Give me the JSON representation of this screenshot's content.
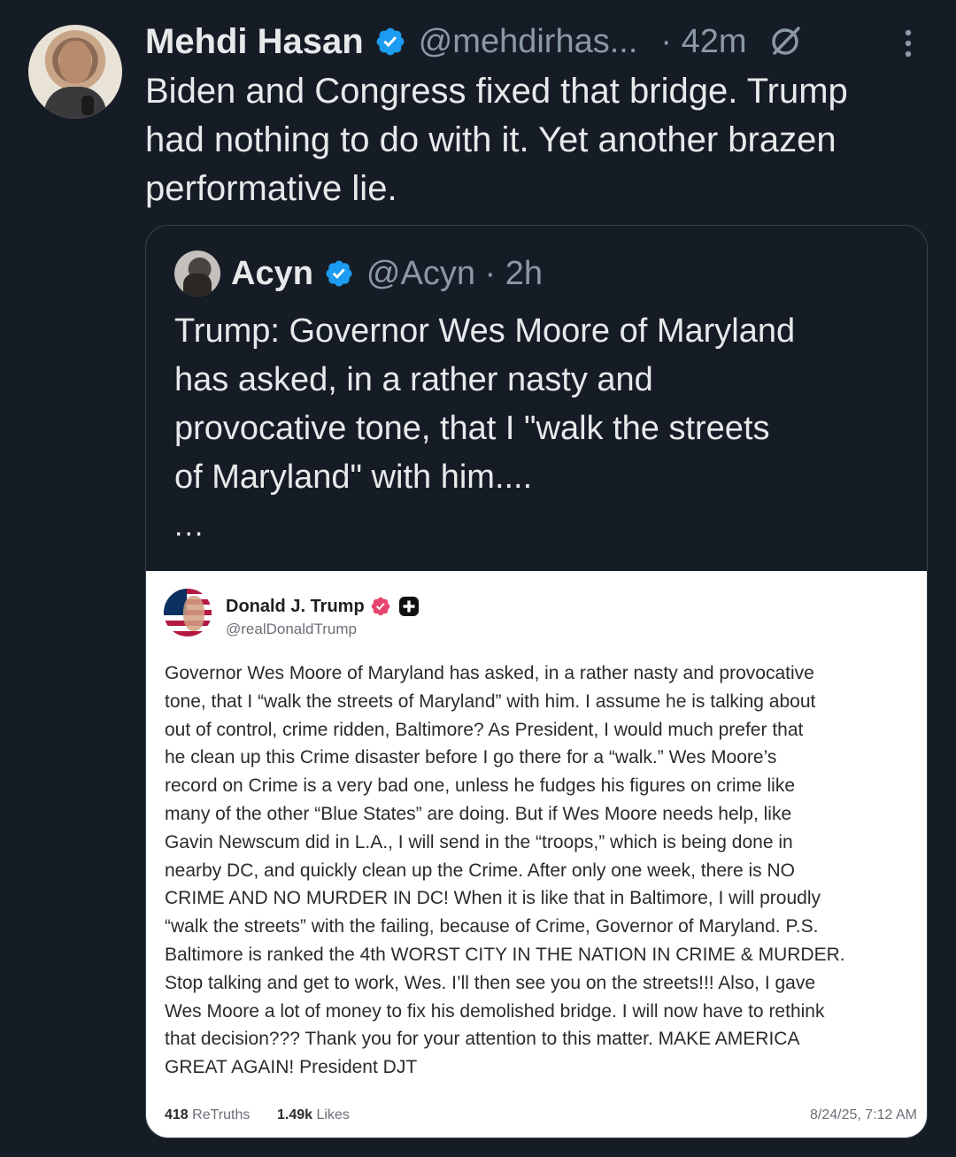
{
  "tweet": {
    "author_name": "Mehdi Hasan",
    "handle": "@mehdirhas...",
    "time": "· 42m",
    "text": "Biden and Congress fixed that bridge. Trump\nhad nothing to do with it. Yet another brazen\nperformative lie."
  },
  "quote": {
    "author_name": "Acyn",
    "handle": "@Acyn · 2h",
    "text": "Trump: Governor Wes Moore of Maryland\nhas asked, in a rather nasty and\nprovocative tone, that I \"walk the streets\nof Maryland\" with him....",
    "ellipsis": "..."
  },
  "embed": {
    "author_name": "Donald J. Trump",
    "handle": "@realDonaldTrump",
    "body": "Governor Wes Moore of Maryland has asked, in a rather nasty and provocative\ntone, that I “walk the streets of Maryland” with him. I assume he is talking about\nout of control, crime ridden, Baltimore? As President, I would much prefer that\nhe clean up this Crime disaster before I go there for a “walk.” Wes Moore’s\nrecord on Crime is a very bad one, unless he fudges his figures on crime like\nmany of the other “Blue States” are doing. But if Wes Moore needs help, like\nGavin Newscum did in L.A., I will send in the “troops,” which is being done in\nnearby DC, and quickly clean up the Crime. After only one week, there is NO\nCRIME AND NO MURDER IN DC! When it is like that in Baltimore, I will proudly\n“walk the streets” with the failing, because of Crime, Governor of Maryland. P.S.\nBaltimore is ranked the 4th WORST CITY IN THE NATION IN CRIME & MURDER.\nStop talking and get to work, Wes. I’ll then see you on the streets!!! Also, I gave\nWes Moore a lot of money to fix his demolished bridge. I will now have to rethink\nthat decision??? Thank you for your attention to this matter. MAKE AMERICA\nGREAT AGAIN! President DJT",
    "retruths_count": "418",
    "retruths_label": "ReTruths",
    "likes_count": "1.49k",
    "likes_label": "Likes",
    "date": "8/24/25, 7:12 AM"
  },
  "colors": {
    "background": "#161c26",
    "text_primary": "#e7e9ea",
    "text_secondary": "#8b98a5",
    "verified_blue": "#1d9bf0",
    "truth_verified": "#e6456f"
  }
}
